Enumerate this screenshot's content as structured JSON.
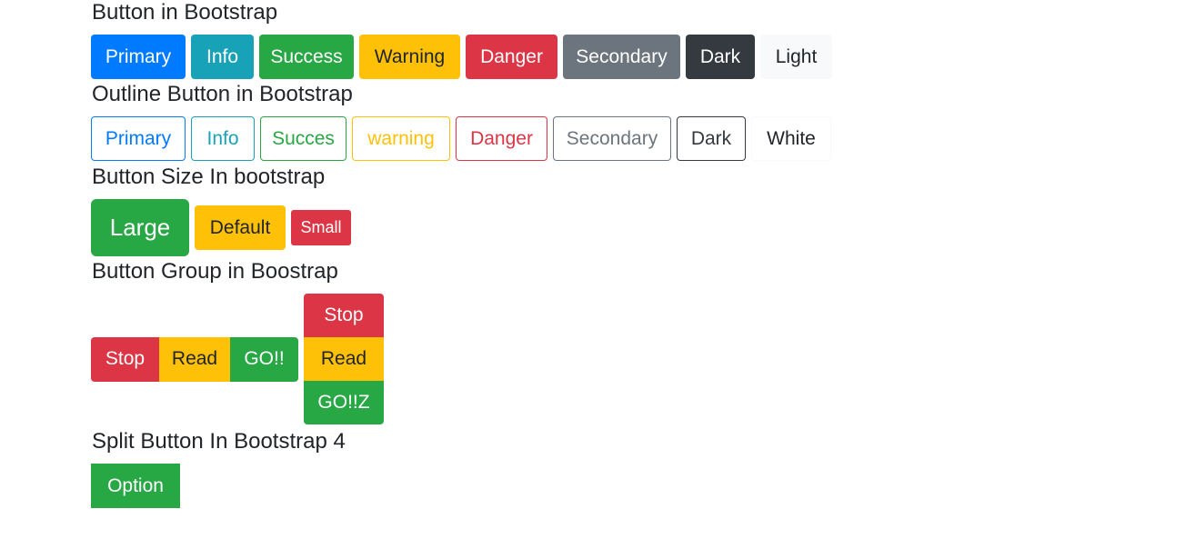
{
  "sections": {
    "basic_title": "Button in Bootstrap",
    "outline_title": "Outline Button in Bootstrap",
    "size_title": "Button Size In bootstrap",
    "group_title": "Button Group in Boostrap",
    "split_title": "Split Button In Bootstrap 4"
  },
  "basic_buttons": [
    "Primary",
    "Info",
    "Success",
    "Warning",
    "Danger",
    "Secondary",
    "Dark",
    "Light"
  ],
  "outline_buttons": [
    "Primary",
    "Info",
    "Succes",
    "warning",
    "Danger",
    "Secondary",
    "Dark",
    "White"
  ],
  "size_buttons": {
    "large": "Large",
    "default": "Default",
    "small": "Small"
  },
  "horizontal_group": [
    "Stop",
    "Read",
    "GO!!"
  ],
  "vertical_group": [
    "Stop",
    "Read",
    "GO!!Z"
  ],
  "split_button": {
    "label": "Option"
  },
  "colors": {
    "primary": "#007bff",
    "info": "#17a2b8",
    "success": "#28a745",
    "warning": "#ffc107",
    "danger": "#dc3545",
    "secondary": "#6c757d",
    "dark": "#343a40",
    "light": "#f8f9fa"
  }
}
